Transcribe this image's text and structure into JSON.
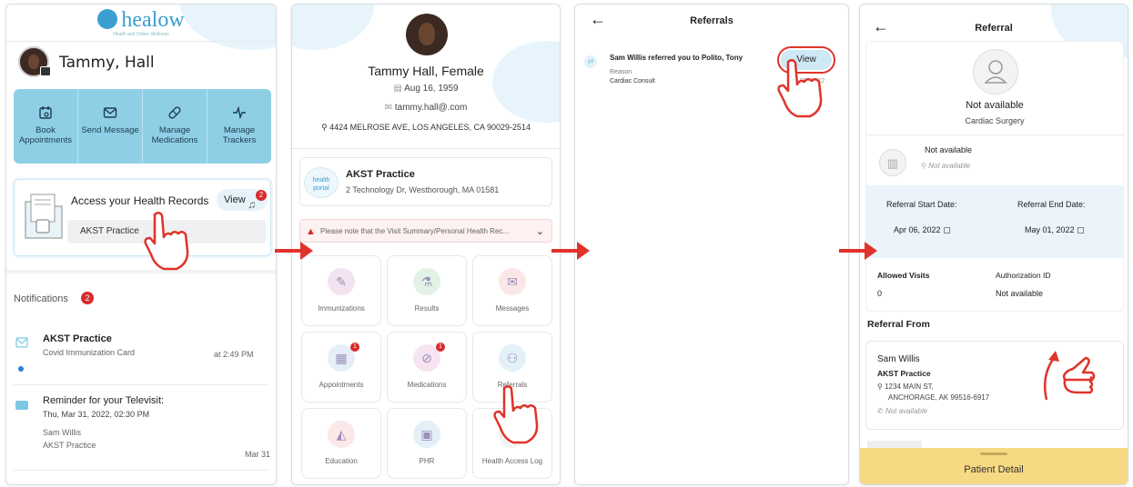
{
  "colors": {
    "accent": "#3a9fd0",
    "quick_actions_bg": "#8fcfe6",
    "arrow": "#e0332a",
    "badge": "#d62b2b",
    "bottom_bar": "#f7d983"
  },
  "panel1": {
    "logo": "healow",
    "logo_tagline": "Health and Online Wellness",
    "user_name": "Tammy, Hall",
    "quick_actions": [
      {
        "label": "Book Appointments",
        "icon": "calendar-icon"
      },
      {
        "label": "Send Message",
        "icon": "envelope-icon"
      },
      {
        "label": "Manage Medications",
        "icon": "pill-icon"
      },
      {
        "label": "Manage Trackers",
        "icon": "pulse-icon"
      }
    ],
    "records": {
      "title": "Access your Health Records",
      "view_label": "View",
      "badge": "2",
      "practice": "AKST Practice"
    },
    "notifications": {
      "title": "Notifications",
      "count": "2",
      "items": [
        {
          "title": "AKST Practice",
          "subtitle": "Covid Immunization Card",
          "time": "at 2:49 PM"
        },
        {
          "title": "Reminder for your Televisit:",
          "subtitle": "Thu, Mar 31, 2022, 02:30 PM",
          "line3": "Sam Willis",
          "line4": "AKST Practice",
          "time": "Mar 31"
        }
      ]
    }
  },
  "panel2": {
    "name": "Tammy Hall, Female",
    "dob": "Aug 16, 1959",
    "email": "tammy.hall@.com",
    "address": "4424 MELROSE AVE, LOS ANGELES, CA 90029-2514",
    "practice_logo": "health portal",
    "practice": {
      "name": "AKST Practice",
      "address": "2 Technology Dr, Westborough, MA 01581"
    },
    "notice": "Please note that the Visit Summary/Personal Health Rec...",
    "tiles": [
      {
        "label": "Immunizations",
        "icon": "syringe-icon",
        "color": "#f3e3f0",
        "glyph": "✎",
        "badge": ""
      },
      {
        "label": "Results",
        "icon": "flask-icon",
        "color": "#e2f3e6",
        "glyph": "⚗",
        "badge": ""
      },
      {
        "label": "Messages",
        "icon": "envelope-icon",
        "color": "#fbe7e7",
        "glyph": "✉",
        "badge": ""
      },
      {
        "label": "Appointments",
        "icon": "calendar-icon",
        "color": "#e6eef8",
        "glyph": "▦",
        "badge": "1"
      },
      {
        "label": "Medications",
        "icon": "pill-icon",
        "color": "#f6e4f1",
        "glyph": "⊘",
        "badge": "1"
      },
      {
        "label": "Referrals",
        "icon": "referral-icon",
        "color": "#e4f0f8",
        "glyph": "⚇",
        "badge": ""
      },
      {
        "label": "Education",
        "icon": "graduation-cap-icon",
        "color": "#fbe8e8",
        "glyph": "◭",
        "badge": ""
      },
      {
        "label": "PHR",
        "icon": "document-icon",
        "color": "#e4f0f8",
        "glyph": "▣",
        "badge": ""
      },
      {
        "label": "Health Access Log",
        "icon": "log-icon",
        "color": "#f3f3f3",
        "glyph": "",
        "badge": ""
      }
    ]
  },
  "panel3": {
    "title": "Referrals",
    "referral": {
      "title": "Sam Willis referred you to Polito, Tony",
      "reason_label": "Reason",
      "reason": "Cardiac Consult",
      "date": "Apr 06, 2022",
      "view_label": "View"
    }
  },
  "panel4": {
    "title": "Referral",
    "doctor": {
      "name": "Not available",
      "specialty": "Cardiac Surgery"
    },
    "facility": {
      "name": "Not available",
      "location": "Not available"
    },
    "start": {
      "label": "Referral Start Date:",
      "value": "Apr 06, 2022"
    },
    "end": {
      "label": "Referral End Date:",
      "value": "May 01, 2022"
    },
    "allowed_visits": {
      "label": "Allowed Visits",
      "value": "0"
    },
    "authorization": {
      "label": "Authorization ID",
      "value": "Not available"
    },
    "from_title": "Referral From",
    "from": {
      "name": "Sam Willis",
      "practice": "AKST Practice",
      "address1": "1234 MAIN ST,",
      "address2": "ANCHORAGE, AK 99516-6917",
      "phone": "Not available"
    },
    "patient_detail": "Patient Detail"
  }
}
